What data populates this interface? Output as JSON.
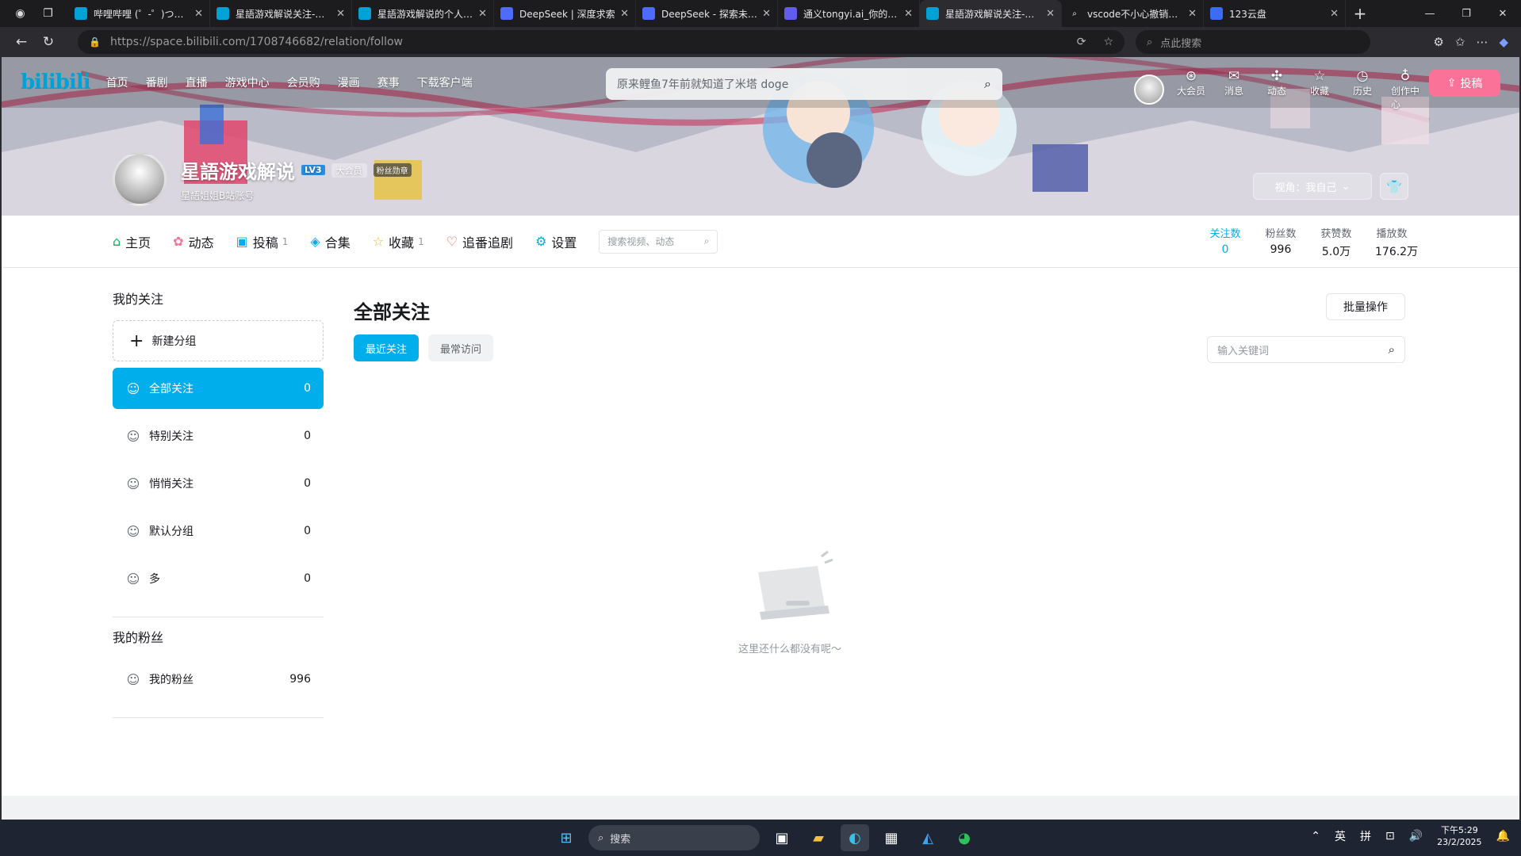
{
  "browser": {
    "tabs": [
      {
        "title": "哔哩哔哩 (゜-゜)つロ 干杯~",
        "icon": "bilibili-icon",
        "color": "#00a1d6"
      },
      {
        "title": "星語游戏解说关注-星語",
        "icon": "bilibili-icon",
        "color": "#00a1d6"
      },
      {
        "title": "星語游戏解说的个人空间",
        "icon": "bilibili-icon",
        "color": "#00a1d6"
      },
      {
        "title": "DeepSeek | 深度求索",
        "icon": "deepseek-icon",
        "color": "#4d6bfe"
      },
      {
        "title": "DeepSeek - 探索未至之境",
        "icon": "deepseek-icon",
        "color": "#4d6bfe"
      },
      {
        "title": "通义tongyi.ai_你的全能AI助手",
        "icon": "tongyi-icon",
        "color": "#615ced"
      },
      {
        "title": "星語游戏解说关注-星語",
        "icon": "bilibili-icon",
        "color": "#00a1d6",
        "active": true
      },
      {
        "title": "vscode不小心撤销了怎么恢复",
        "icon": "search-icon",
        "color": "#1c1c1f"
      },
      {
        "title": "123云盘",
        "icon": "cloud-icon",
        "color": "#3b6cf6"
      }
    ],
    "url_host": "https://space.bilibili.com",
    "url_path": "/1708746682/relation/follow",
    "search_placeholder": "点此搜索"
  },
  "header": {
    "logo": "bilibili",
    "nav": [
      "首页",
      "番剧",
      "直播",
      "游戏中心",
      "会员购",
      "漫画",
      "赛事",
      "下载客户端"
    ],
    "search_placeholder": "原来鲤鱼7年前就知道了米塔 doge",
    "icons": [
      {
        "label": "大会员",
        "icon": "vip-icon"
      },
      {
        "label": "消息",
        "icon": "message-icon"
      },
      {
        "label": "动态",
        "icon": "dynamic-icon"
      },
      {
        "label": "收藏",
        "icon": "star-icon"
      },
      {
        "label": "历史",
        "icon": "history-icon"
      },
      {
        "label": "创作中心",
        "icon": "bulb-icon"
      }
    ],
    "upload": "投稿"
  },
  "profile": {
    "name": "星語游戏解说",
    "level": "LV3",
    "vip": "大会员",
    "fan_medal": "粉丝勋章",
    "sign": "星語姐姐B站账号",
    "view_as": "视角：我自己"
  },
  "profile_nav": [
    {
      "label": "主页",
      "icon": "home-icon",
      "count": "",
      "color": "#00b85c"
    },
    {
      "label": "动态",
      "icon": "dynamic-icon",
      "count": "",
      "color": "#fb7299"
    },
    {
      "label": "投稿",
      "icon": "video-icon",
      "count": "1",
      "color": "#00aeec"
    },
    {
      "label": "合集",
      "icon": "collection-icon",
      "count": "",
      "color": "#00aeec"
    },
    {
      "label": "收藏",
      "icon": "star-icon",
      "count": "1",
      "color": "#ffb027"
    },
    {
      "label": "追番追剧",
      "icon": "heart-icon",
      "count": "",
      "color": "#f85a54"
    },
    {
      "label": "设置",
      "icon": "settings-icon",
      "count": "",
      "color": "#00aeec"
    }
  ],
  "profile_search_placeholder": "搜索视频、动态",
  "stats": [
    {
      "label": "关注数",
      "value": "0",
      "active": true
    },
    {
      "label": "粉丝数",
      "value": "996"
    },
    {
      "label": "获赞数",
      "value": "5.0万"
    },
    {
      "label": "播放数",
      "value": "176.2万"
    }
  ],
  "sidebar": {
    "my_follow_title": "我的关注",
    "new_group": "新建分组",
    "groups": [
      {
        "label": "全部关注",
        "count": "0",
        "active": true
      },
      {
        "label": "特别关注",
        "count": "0"
      },
      {
        "label": "悄悄关注",
        "count": "0"
      },
      {
        "label": "默认分组",
        "count": "0"
      },
      {
        "label": "多",
        "count": "0"
      }
    ],
    "my_fans_title": "我的粉丝",
    "fans": {
      "label": "我的粉丝",
      "count": "996"
    }
  },
  "main": {
    "title": "全部关注",
    "batch": "批量操作",
    "tabs": [
      {
        "label": "最近关注",
        "active": true
      },
      {
        "label": "最常访问"
      }
    ],
    "search_placeholder": "输入关键词",
    "empty_text": "这里还什么都没有呢～"
  },
  "taskbar": {
    "search": "搜索",
    "ime1": "英",
    "ime2": "拼",
    "time": "下午5:29",
    "date": "23/2/2025"
  }
}
